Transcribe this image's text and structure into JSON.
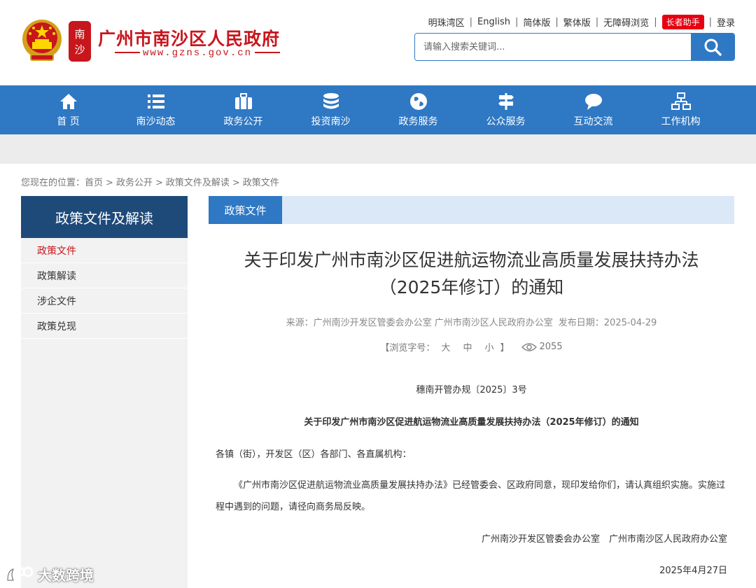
{
  "header": {
    "site_title": "广州市南沙区人民政府",
    "site_url": "www.gzns.gov.cn",
    "seal_text": "南沙",
    "toplinks": [
      "明珠湾区",
      "English",
      "简体版",
      "繁体版",
      "无障碍浏览",
      "长者助手",
      "登录"
    ],
    "search_placeholder": "请输入搜索关键词..."
  },
  "nav": [
    {
      "label": "首 页",
      "icon": "home-icon"
    },
    {
      "label": "南沙动态",
      "icon": "list-icon"
    },
    {
      "label": "政务公开",
      "icon": "briefcase-icon"
    },
    {
      "label": "投资南沙",
      "icon": "coins-icon"
    },
    {
      "label": "政务服务",
      "icon": "globe-icon"
    },
    {
      "label": "公众服务",
      "icon": "signpost-icon"
    },
    {
      "label": "互动交流",
      "icon": "chat-icon"
    },
    {
      "label": "工作机构",
      "icon": "org-chart-icon"
    }
  ],
  "breadcrumb": {
    "prefix": "您现在的位置：",
    "items": [
      "首页",
      "政务公开",
      "政策文件及解读",
      "政策文件"
    ]
  },
  "sidebar": {
    "title": "政策文件及解读",
    "items": [
      "政策文件",
      "政策解读",
      "涉企文件",
      "政策兑现"
    ]
  },
  "main": {
    "tab": "政策文件",
    "title_line1": "关于印发广州市南沙区促进航运物流业高质量发展扶持办法",
    "title_line2": "（2025年修订）的通知",
    "source": "来源：广州南沙开发区管委会办公室 广州市南沙区人民政府办公室",
    "publish_date": "发布日期：2025-04-29",
    "font_size_label": "【浏览字号：",
    "font_sizes": [
      "大",
      "中",
      "小"
    ],
    "font_size_close": "】",
    "views": "2055",
    "doc_number": "穗南开管办规〔2025〕3号",
    "doc_title": "关于印发广州市南沙区促进航运物流业高质量发展扶持办法（2025年修订）的通知",
    "addressee": "各镇（街），开发区（区）各部门、各直属机构：",
    "body": "《广州市南沙区促进航运物流业高质量发展扶持办法》已经管委会、区政府同意，现印发给你们，请认真组织实施。实施过程中遇到的问题，请径向商务局反映。",
    "signature": "广州南沙开发区管委会办公室　广州市南沙区人民政府办公室",
    "date": "2025年4月27日"
  },
  "watermark": "大数跨境",
  "colors": {
    "brand_red": "#c8161d",
    "nav_blue": "#2f78c4",
    "sidebar_navy": "#1e4a7a",
    "elder_red": "#e60012"
  }
}
